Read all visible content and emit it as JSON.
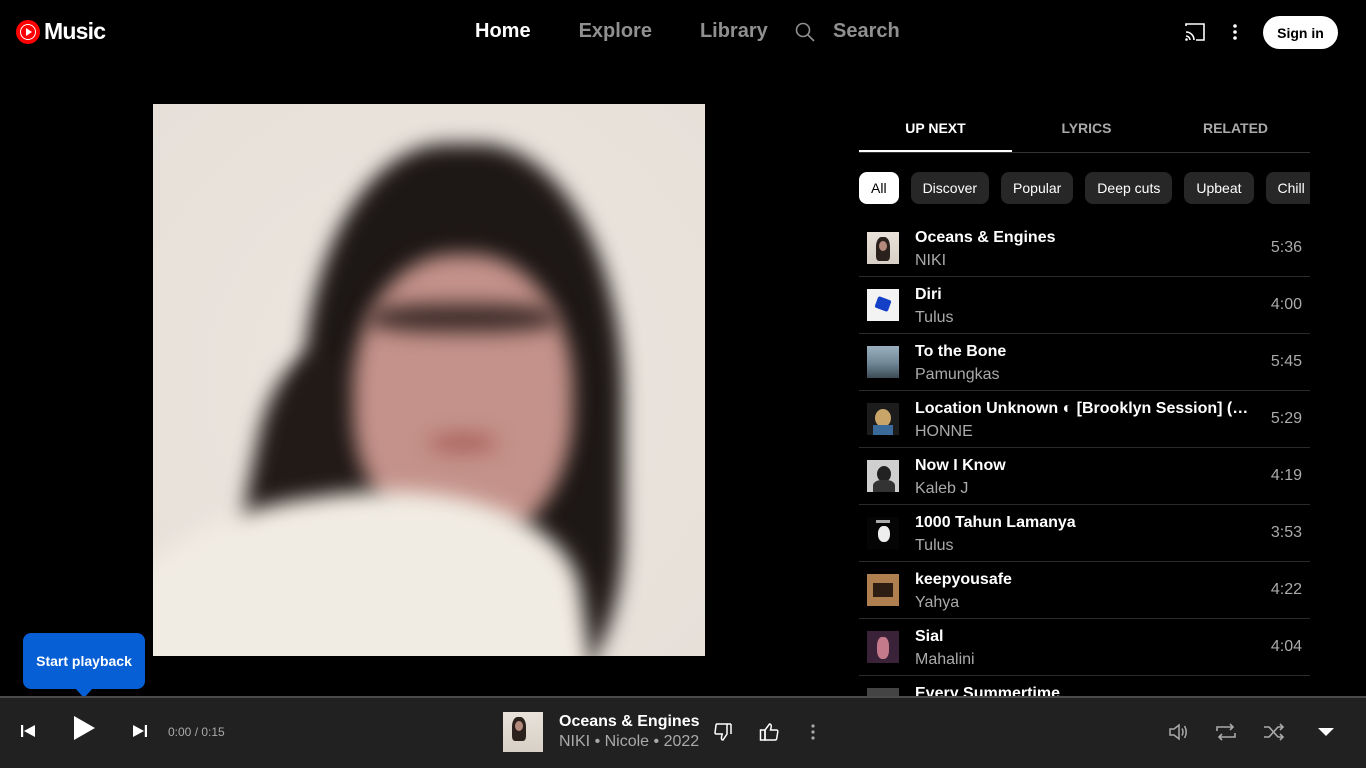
{
  "app": {
    "logo_text": "Music"
  },
  "nav": {
    "items": [
      {
        "label": "Home",
        "active": true
      },
      {
        "label": "Explore",
        "active": false
      },
      {
        "label": "Library",
        "active": false
      }
    ],
    "search_label": "Search",
    "sign_in_label": "Sign in"
  },
  "tooltip": {
    "text": "Start playback"
  },
  "panel": {
    "tabs": [
      {
        "label": "UP NEXT",
        "active": true
      },
      {
        "label": "LYRICS",
        "active": false
      },
      {
        "label": "RELATED",
        "active": false
      }
    ],
    "chips": [
      {
        "label": "All",
        "active": true
      },
      {
        "label": "Discover",
        "active": false
      },
      {
        "label": "Popular",
        "active": false
      },
      {
        "label": "Deep cuts",
        "active": false
      },
      {
        "label": "Upbeat",
        "active": false
      },
      {
        "label": "Chill",
        "active": false
      }
    ],
    "queue": [
      {
        "title": "Oceans & Engines",
        "artist": "NIKI",
        "duration": "5:36"
      },
      {
        "title": "Diri",
        "artist": "Tulus",
        "duration": "4:00"
      },
      {
        "title": "To the Bone",
        "artist": "Pamungkas",
        "duration": "5:45"
      },
      {
        "title": "Location Unknown ◐ [Brooklyn Session] (feat. Georgia)",
        "artist": "HONNE",
        "duration": "5:29"
      },
      {
        "title": "Now I Know",
        "artist": "Kaleb J",
        "duration": "4:19"
      },
      {
        "title": "1000 Tahun Lamanya",
        "artist": "Tulus",
        "duration": "3:53"
      },
      {
        "title": "keepyousafe",
        "artist": "Yahya",
        "duration": "4:22"
      },
      {
        "title": "Sial",
        "artist": "Mahalini",
        "duration": "4:04"
      },
      {
        "title": "Every Summertime",
        "artist": "",
        "duration": ""
      }
    ]
  },
  "player": {
    "time": "0:00 / 0:15",
    "progress_fraction": 0,
    "now_playing": {
      "title": "Oceans & Engines",
      "subtitle": "NIKI • Nicole • 2022"
    }
  },
  "colors": {
    "background": "#000000",
    "player_bar": "#212121",
    "tooltip": "#065fd4",
    "brand_red": "#ff0000"
  }
}
